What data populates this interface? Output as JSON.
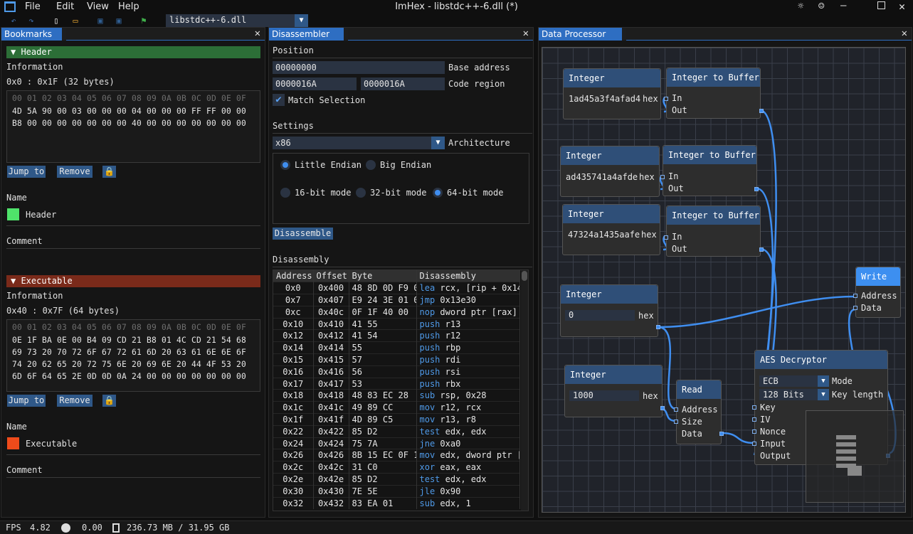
{
  "app": {
    "title": "ImHex - libstdc++-6.dll (*)",
    "menu": [
      "File",
      "Edit",
      "View",
      "Help"
    ],
    "provider": "libstdc++-6.dll"
  },
  "colors": {
    "accent": "#2e6ec2",
    "header_bookmark": "#2c6e37",
    "exec_bookmark": "#7a2a1a",
    "header_swatch": "#4fe26a",
    "exec_swatch": "#ef4b1b"
  },
  "bookmarks": {
    "tab": "Bookmarks",
    "items": [
      {
        "title": "Header",
        "information_label": "Information",
        "range": "0x0 : 0x1F (32 bytes)",
        "hex_header": "00 01 02 03 04 05 06 07 08 09 0A 0B 0C 0D 0E 0F",
        "hex_rows": [
          "4D 5A 90 00 03 00 00 00 04 00 00 00 FF FF 00 00",
          "B8 00 00 00 00 00 00 00 40 00 00 00 00 00 00 00"
        ],
        "jump_label": "Jump to",
        "remove_label": "Remove",
        "name_label": "Name",
        "name": "Header",
        "comment_label": "Comment"
      },
      {
        "title": "Executable",
        "information_label": "Information",
        "range": "0x40 : 0x7F (64 bytes)",
        "hex_header": "00 01 02 03 04 05 06 07 08 09 0A 0B 0C 0D 0E 0F",
        "hex_rows": [
          "0E 1F BA 0E 00 B4 09 CD 21 B8 01 4C CD 21 54 68",
          "69 73 20 70 72 6F 67 72 61 6D 20 63 61 6E 6E 6F",
          "74 20 62 65 20 72 75 6E 20 69 6E 20 44 4F 53 20",
          "6D 6F 64 65 2E 0D 0D 0A 24 00 00 00 00 00 00 00"
        ],
        "jump_label": "Jump to",
        "remove_label": "Remove",
        "name_label": "Name",
        "name": "Executable",
        "comment_label": "Comment"
      }
    ]
  },
  "disassembler": {
    "tab": "Disassembler",
    "position_label": "Position",
    "base_value": "00000000",
    "base_label": "Base address",
    "region_start": "0000016A",
    "region_end": "0000016A",
    "region_label": "Code region",
    "match_label": "Match Selection",
    "settings_label": "Settings",
    "architecture": "x86",
    "architecture_label": "Architecture",
    "little": "Little Endian",
    "big": "Big Endian",
    "m16": "16-bit mode",
    "m32": "32-bit mode",
    "m64": "64-bit mode",
    "disassemble_label": "Disassemble",
    "disassembly_label": "Disassembly",
    "columns": [
      "Address",
      "Offset",
      "Byte",
      "Disassembly"
    ],
    "rows": [
      [
        "0x0",
        "0x400",
        "48 8D 0D F9 0",
        "lea",
        "rcx, [rip + 0x14"
      ],
      [
        "0x7",
        "0x407",
        "E9 24 3E 01 0",
        "jmp",
        "0x13e30"
      ],
      [
        "0xc",
        "0x40c",
        "0F 1F 40 00",
        "nop",
        "dword ptr [rax]"
      ],
      [
        "0x10",
        "0x410",
        "41 55",
        "push",
        "r13"
      ],
      [
        "0x12",
        "0x412",
        "41 54",
        "push",
        "r12"
      ],
      [
        "0x14",
        "0x414",
        "55",
        "push",
        "rbp"
      ],
      [
        "0x15",
        "0x415",
        "57",
        "push",
        "rdi"
      ],
      [
        "0x16",
        "0x416",
        "56",
        "push",
        "rsi"
      ],
      [
        "0x17",
        "0x417",
        "53",
        "push",
        "rbx"
      ],
      [
        "0x18",
        "0x418",
        "48 83 EC 28",
        "sub",
        "rsp, 0x28"
      ],
      [
        "0x1c",
        "0x41c",
        "49 89 CC",
        "mov",
        "r12, rcx"
      ],
      [
        "0x1f",
        "0x41f",
        "4D 89 C5",
        "mov",
        "r13, r8"
      ],
      [
        "0x22",
        "0x422",
        "85 D2",
        "test",
        "edx, edx"
      ],
      [
        "0x24",
        "0x424",
        "75 7A",
        "jne",
        "0xa0"
      ],
      [
        "0x26",
        "0x426",
        "8B 15 EC 0F 1",
        "mov",
        "edx, dword ptr ["
      ],
      [
        "0x2c",
        "0x42c",
        "31 C0",
        "xor",
        "eax, eax"
      ],
      [
        "0x2e",
        "0x42e",
        "85 D2",
        "test",
        "edx, edx"
      ],
      [
        "0x30",
        "0x430",
        "7E 5E",
        "jle",
        "0x90"
      ],
      [
        "0x32",
        "0x432",
        "83 EA 01",
        "sub",
        "edx, 1"
      ]
    ]
  },
  "data_processor": {
    "tab": "Data Processor",
    "int1": {
      "title": "Integer",
      "value": "1ad45a3f4afad4",
      "unit": "hex"
    },
    "itb1": {
      "title": "Integer to Buffer",
      "in": "In",
      "out": "Out"
    },
    "int2": {
      "title": "Integer",
      "value": "ad435741a4afde",
      "unit": "hex"
    },
    "itb2": {
      "title": "Integer to Buffer",
      "in": "In",
      "out": "Out"
    },
    "int3": {
      "title": "Integer",
      "value": "47324a1435aafe",
      "unit": "hex"
    },
    "itb3": {
      "title": "Integer to Buffer",
      "in": "In",
      "out": "Out"
    },
    "int4": {
      "title": "Integer",
      "value": "0",
      "unit": "hex"
    },
    "write": {
      "title": "Write",
      "address": "Address",
      "data": "Data"
    },
    "int5": {
      "title": "Integer",
      "value": "1000",
      "unit": "hex"
    },
    "read": {
      "title": "Read",
      "address": "Address",
      "size": "Size",
      "data": "Data"
    },
    "aes": {
      "title": "AES Decryptor",
      "mode": "ECB",
      "mode_label": "Mode",
      "keylen": "128 Bits",
      "keylen_label": "Key length",
      "key": "Key",
      "iv": "IV",
      "nonce": "Nonce",
      "input": "Input",
      "output": "Output"
    }
  },
  "status": {
    "fps_label": "FPS",
    "fps": "4.82",
    "time": "0.00",
    "memory": "236.73 MB / 31.95 GB"
  }
}
